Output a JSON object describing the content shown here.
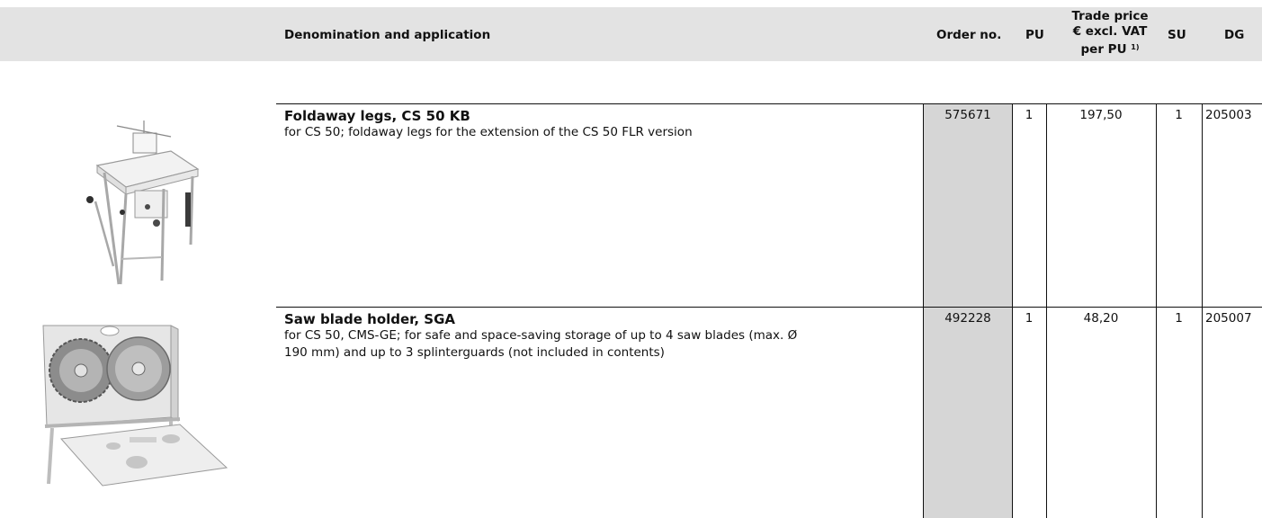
{
  "header": {
    "denomination": "Denomination and application",
    "order_no": "Order no.",
    "pu": "PU",
    "price_line1": "Trade price",
    "price_line2": "€ excl. VAT",
    "price_line3": "per PU",
    "price_footnote": "1)",
    "su": "SU",
    "dg": "DG"
  },
  "products": [
    {
      "image": "foldaway-legs-table-image",
      "title": "Foldaway legs, CS 50 KB",
      "description": "for CS 50; foldaway legs for the extension of the CS 50 FLR version",
      "order_no": "575671",
      "pu": "1",
      "price": "197,50",
      "su": "1",
      "dg": "205003"
    },
    {
      "image": "saw-blade-holder-image",
      "title": "Saw blade holder, SGA",
      "description_line1": "for CS 50, CMS-GE; for safe and space-saving storage of up to 4 saw blades (max. Ø",
      "description_line2": "190 mm) and up to 3 splinterguards (not included in contents)",
      "order_no": "492228",
      "pu": "1",
      "price": "48,20",
      "su": "1",
      "dg": "205007"
    }
  ],
  "colors": {
    "header_bg": "#e3e3e3",
    "order_col_bg": "#d6d6d6",
    "rule": "#111111"
  }
}
